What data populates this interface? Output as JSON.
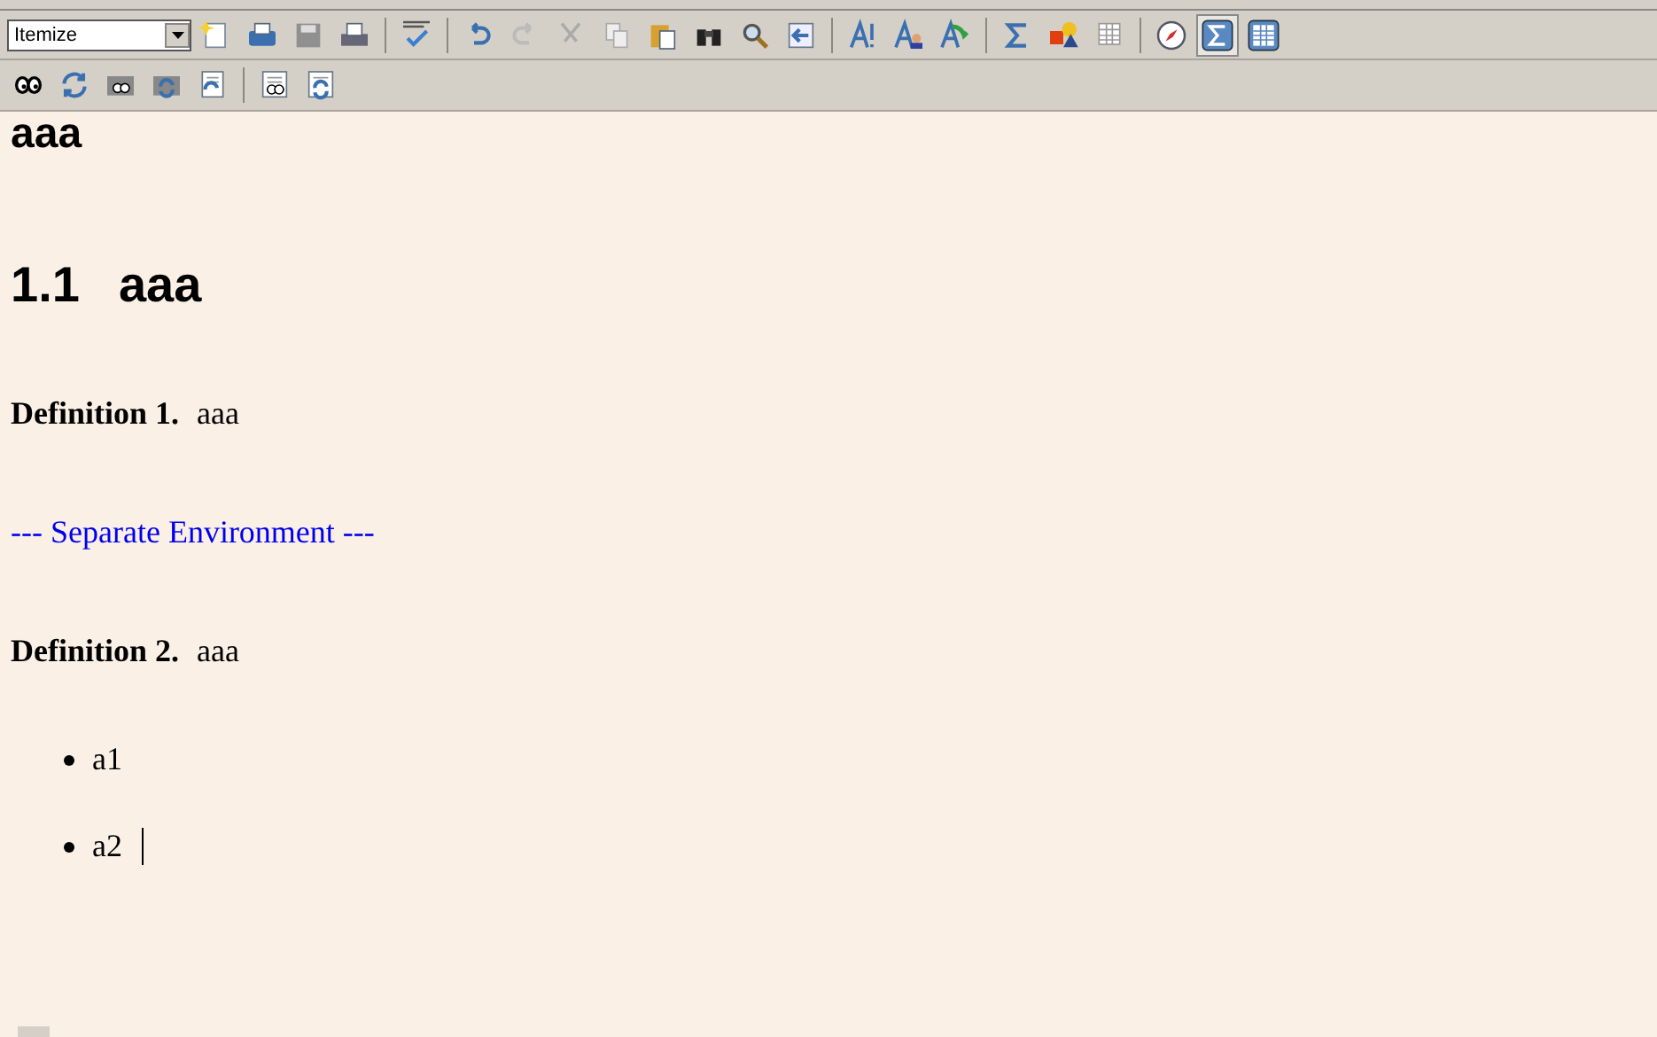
{
  "toolbar": {
    "layout_select": {
      "value": "Itemize"
    },
    "math_panel_toggle": {
      "pressed": true
    },
    "table_panel_toggle": {
      "pressed": false
    }
  },
  "document": {
    "cut_heading": "aaa",
    "section": {
      "number": "1.1",
      "title": "aaa"
    },
    "blocks": [
      {
        "kind": "definition",
        "label": "Definition 1.",
        "text": "aaa"
      },
      {
        "kind": "separator",
        "text": "--- Separate Environment ---"
      },
      {
        "kind": "definition",
        "label": "Definition 2.",
        "text": "aaa"
      },
      {
        "kind": "list",
        "items": [
          {
            "text": "a1",
            "cursor": false
          },
          {
            "text": "a2",
            "cursor": true
          }
        ]
      }
    ]
  }
}
